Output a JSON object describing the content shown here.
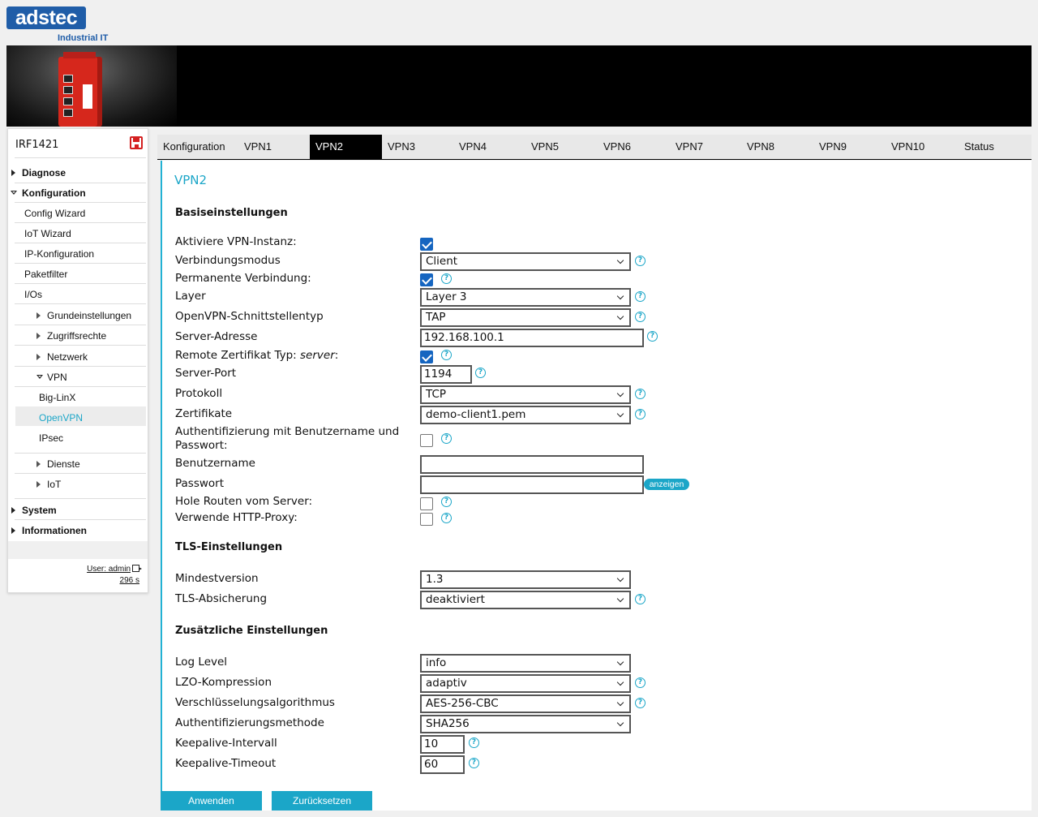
{
  "brand": {
    "logo_text": "adstec",
    "logo_sub": "Industrial IT"
  },
  "sidebar": {
    "device_name": "IRF1421",
    "items": [
      {
        "label": "Diagnose"
      },
      {
        "label": "Konfiguration"
      },
      {
        "label": "Config Wizard"
      },
      {
        "label": "IoT Wizard"
      },
      {
        "label": "IP-Konfiguration"
      },
      {
        "label": "Paketfilter"
      },
      {
        "label": "I/Os"
      },
      {
        "label": "Grundeinstellungen"
      },
      {
        "label": "Zugriffsrechte"
      },
      {
        "label": "Netzwerk"
      },
      {
        "label": "VPN"
      },
      {
        "label": "Big-LinX"
      },
      {
        "label": "OpenVPN"
      },
      {
        "label": "IPsec"
      },
      {
        "label": "Dienste"
      },
      {
        "label": "IoT"
      },
      {
        "label": "System"
      },
      {
        "label": "Informationen"
      }
    ],
    "user_label": "User: admin",
    "timer": "296 s"
  },
  "tabs": [
    {
      "label": "Konfiguration"
    },
    {
      "label": "VPN1"
    },
    {
      "label": "VPN2"
    },
    {
      "label": "VPN3"
    },
    {
      "label": "VPN4"
    },
    {
      "label": "VPN5"
    },
    {
      "label": "VPN6"
    },
    {
      "label": "VPN7"
    },
    {
      "label": "VPN8"
    },
    {
      "label": "VPN9"
    },
    {
      "label": "VPN10"
    },
    {
      "label": "Status"
    }
  ],
  "active_tab": "VPN2",
  "page_title": "VPN2",
  "sections": {
    "basic": "Basiseinstellungen",
    "tls": "TLS-Einstellungen",
    "extra": "Zusätzliche Einstellungen"
  },
  "fields": {
    "aktiviere": {
      "label": "Aktiviere VPN-Instanz:",
      "checked": true
    },
    "modus": {
      "label": "Verbindungsmodus",
      "value": "Client"
    },
    "permanent": {
      "label": "Permanente Verbindung:",
      "checked": true
    },
    "layer": {
      "label": "Layer",
      "value": "Layer 3"
    },
    "schnittstelle": {
      "label": "OpenVPN-Schnittstellentyp",
      "value": "TAP"
    },
    "server_adresse": {
      "label": "Server-Adresse",
      "value": "192.168.100.1"
    },
    "remote_cert": {
      "label_prefix": "Remote Zertifikat Typ: ",
      "label_em": "server",
      "label_suffix": ":",
      "checked": true
    },
    "server_port": {
      "label": "Server-Port",
      "value": "1194"
    },
    "protokoll": {
      "label": "Protokoll",
      "value": "TCP"
    },
    "zertifikate": {
      "label": "Zertifikate",
      "value": "demo-client1.pem"
    },
    "auth_user": {
      "label": "Authentifizierung mit Benutzername und Passwort:",
      "checked": false
    },
    "benutzername": {
      "label": "Benutzername",
      "value": ""
    },
    "passwort": {
      "label": "Passwort",
      "value": "",
      "show_label": "anzeigen"
    },
    "routen": {
      "label": "Hole Routen vom Server:",
      "checked": false
    },
    "proxy": {
      "label": "Verwende HTTP-Proxy:",
      "checked": false
    },
    "mindestversion": {
      "label": "Mindestversion",
      "value": "1.3"
    },
    "tls_absicherung": {
      "label": "TLS-Absicherung",
      "value": "deaktiviert"
    },
    "log_level": {
      "label": "Log Level",
      "value": "info"
    },
    "lzo": {
      "label": "LZO-Kompression",
      "value": "adaptiv"
    },
    "cipher": {
      "label": "Verschlüsselungsalgorithmus",
      "value": "AES-256-CBC"
    },
    "auth_method": {
      "label": "Authentifizierungsmethode",
      "value": "SHA256"
    },
    "keepalive_interval": {
      "label": "Keepalive-Intervall",
      "value": "10"
    },
    "keepalive_timeout": {
      "label": "Keepalive-Timeout",
      "value": "60"
    }
  },
  "buttons": {
    "apply": "Anwenden",
    "reset": "Zurücksetzen"
  },
  "colors": {
    "accent": "#1ba6c8",
    "brand": "#1f5da8",
    "checkbox": "#1565c0"
  },
  "icons": {
    "help": "question-circle-icon",
    "save": "floppy-disk-icon",
    "logout": "logout-icon"
  }
}
